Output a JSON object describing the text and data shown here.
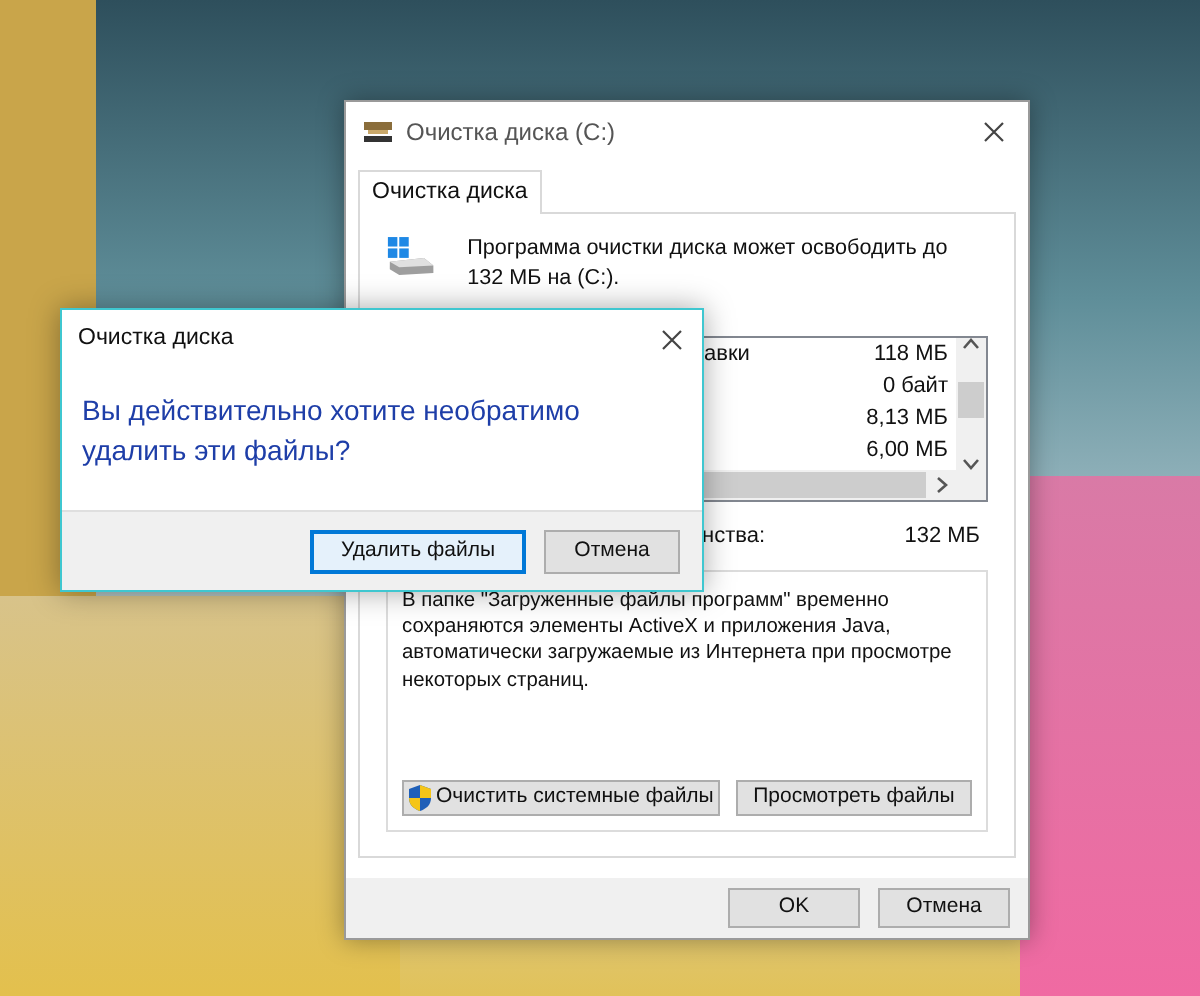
{
  "main_window": {
    "title": "Очистка диска  (C:)",
    "tabs": [
      {
        "label": "Очистка диска",
        "selected": true
      }
    ],
    "summary": "Программа очистки диска может освободить до 132 МБ на  (C:).",
    "files": [
      {
        "name": "авки",
        "size": "118 МБ"
      },
      {
        "size": "0 байт"
      },
      {
        "size": "8,13 МБ"
      },
      {
        "size": "6,00 МБ"
      }
    ],
    "total_label": "нства:",
    "total": "132 МБ",
    "description": "В папке \"Загруженные файлы программ\" временно сохраняются элементы ActiveX и приложения Java, автоматически загружаемые из Интернета при просмотре некоторых страниц.",
    "buttons": [
      {
        "label": "Очистить системные файлы",
        "kind": "shield"
      },
      {
        "label": "Просмотреть файлы",
        "kind": "plain"
      }
    ],
    "footer_buttons": [
      "OK",
      "Отмена"
    ]
  },
  "dialog": {
    "title": "Очистка диска",
    "message": "Вы действительно хотите необратимо удалить эти файлы?",
    "buttons": [
      {
        "label": "Удалить файлы",
        "default": true
      },
      {
        "label": "Отмена",
        "default": false
      }
    ]
  }
}
